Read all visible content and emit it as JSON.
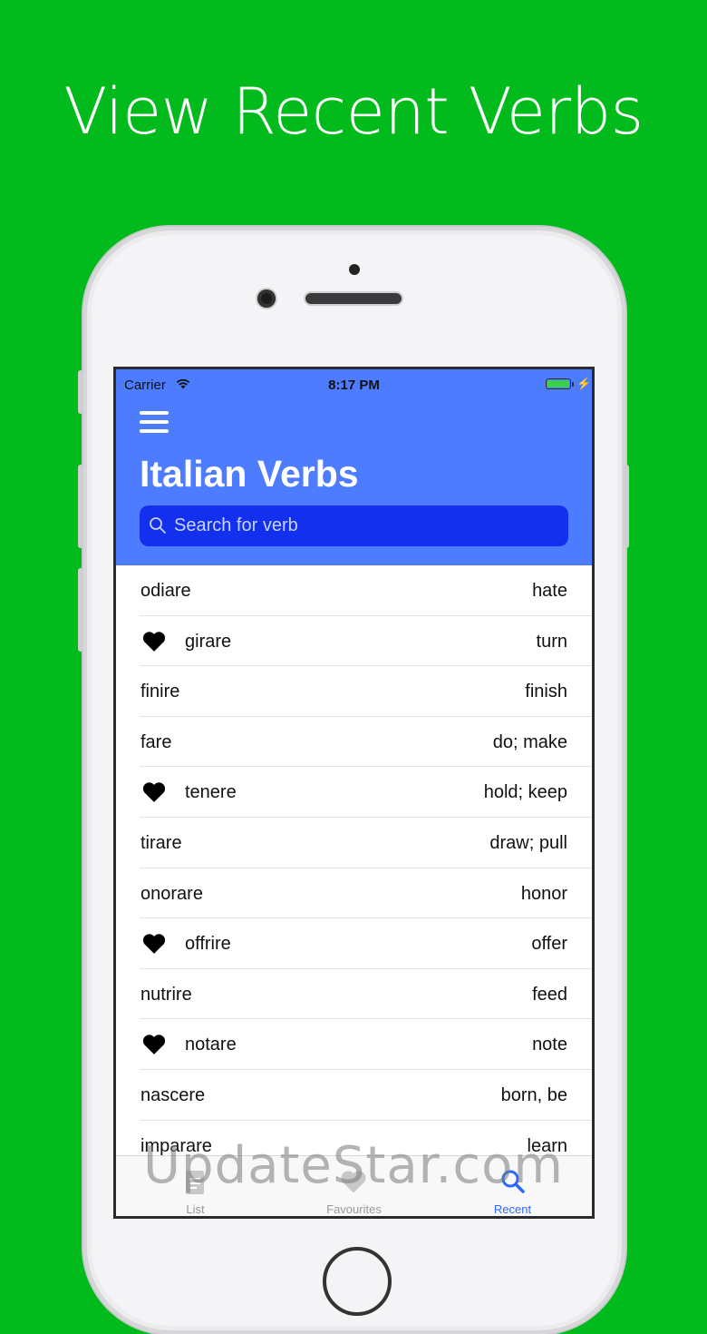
{
  "headline": "View Recent Verbs",
  "status_bar": {
    "carrier": "Carrier",
    "time": "8:17 PM"
  },
  "header": {
    "title": "Italian Verbs"
  },
  "search": {
    "placeholder": "Search for verb"
  },
  "verbs": [
    {
      "verb": "odiare",
      "meaning": "hate",
      "favourite": false
    },
    {
      "verb": "girare",
      "meaning": "turn",
      "favourite": true
    },
    {
      "verb": "finire",
      "meaning": "finish",
      "favourite": false
    },
    {
      "verb": "fare",
      "meaning": "do; make",
      "favourite": false
    },
    {
      "verb": "tenere",
      "meaning": "hold; keep",
      "favourite": true
    },
    {
      "verb": "tirare",
      "meaning": "draw; pull",
      "favourite": false
    },
    {
      "verb": "onorare",
      "meaning": "honor",
      "favourite": false
    },
    {
      "verb": "offrire",
      "meaning": "offer",
      "favourite": true
    },
    {
      "verb": "nutrire",
      "meaning": "feed",
      "favourite": false
    },
    {
      "verb": "notare",
      "meaning": "note",
      "favourite": true
    },
    {
      "verb": "nascere",
      "meaning": "born, be",
      "favourite": false
    },
    {
      "verb": "imparare",
      "meaning": "learn",
      "favourite": false
    }
  ],
  "tabs": [
    {
      "label": "List",
      "icon": "document-icon",
      "active": false
    },
    {
      "label": "Favourites",
      "icon": "heart-icon",
      "active": false
    },
    {
      "label": "Recent",
      "icon": "search-icon",
      "active": true
    }
  ],
  "watermark": "UpdateStar.com",
  "colors": {
    "background": "#00bb1b",
    "header": "#4e7cff",
    "search_field": "#1230ee",
    "active_tab": "#2f68ff"
  }
}
